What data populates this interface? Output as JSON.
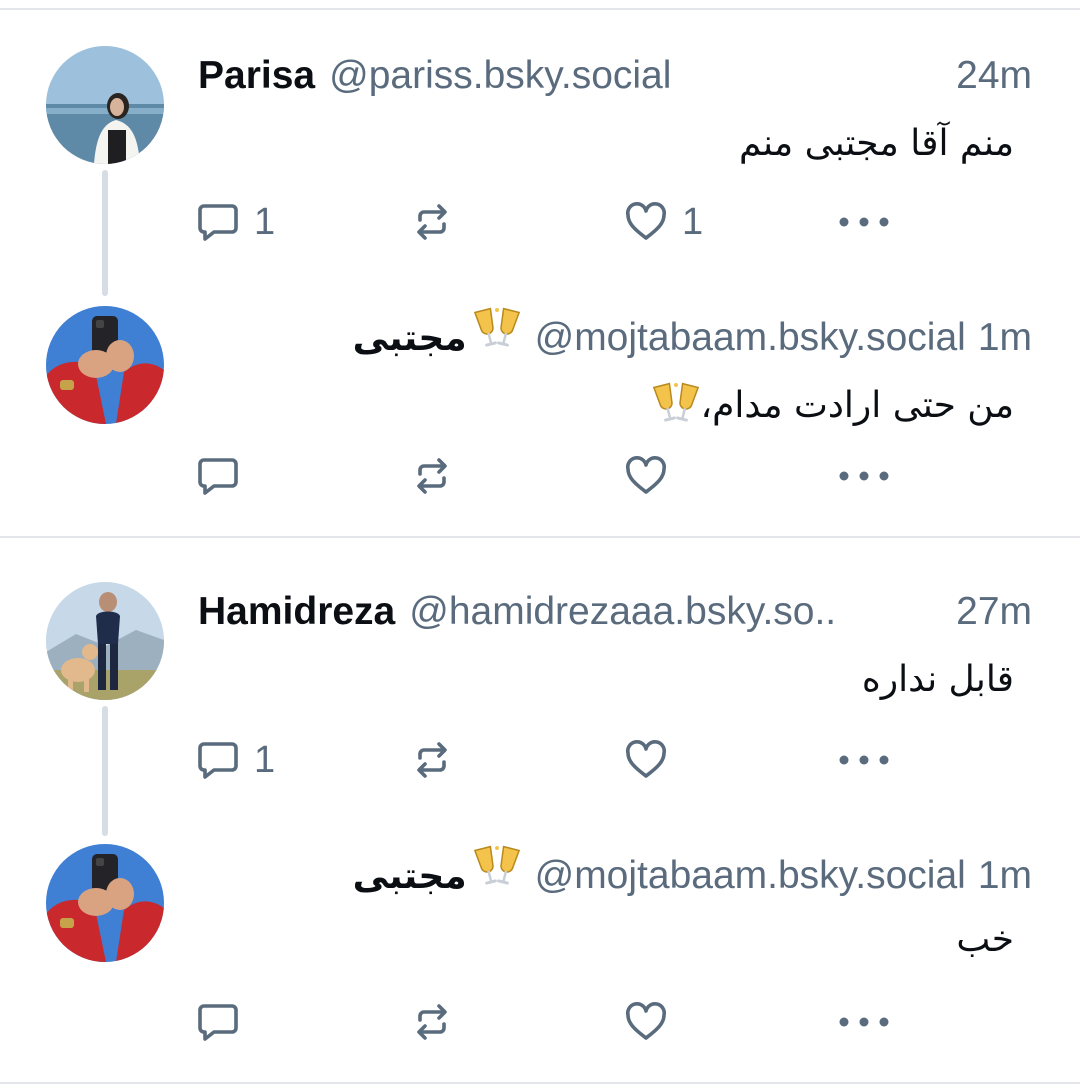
{
  "colors": {
    "muted": "#5a6b7d",
    "divider": "#e3e6ea",
    "thread_line": "#d6dde5"
  },
  "threads": [
    {
      "parent": {
        "name": "Parisa",
        "handle": "@pariss.bsky.social",
        "time": "24m",
        "text": "منم آقا مجتبی منم",
        "reply_count": "1",
        "like_count": "1"
      },
      "reply": {
        "name": "مجتبی",
        "emoji": "champagne-glasses-emoji",
        "handle": "@mojtabaam.bsky.social",
        "time": "1m",
        "text": "من حتی ارادت مدام،"
      }
    },
    {
      "parent": {
        "name": "Hamidreza",
        "handle": "@hamidrezaaa.bsky.so..",
        "time": "27m",
        "text": "قابل نداره",
        "reply_count": "1"
      },
      "reply": {
        "name": "مجتبی",
        "emoji": "champagne-glasses-emoji",
        "handle": "@mojtabaam.bsky.social",
        "time": "1m",
        "text": "خب"
      }
    }
  ],
  "icons": {
    "reply": "speech-bubble-icon",
    "repost": "repost-arrows-icon",
    "like": "heart-icon",
    "more": "ellipsis-icon"
  }
}
